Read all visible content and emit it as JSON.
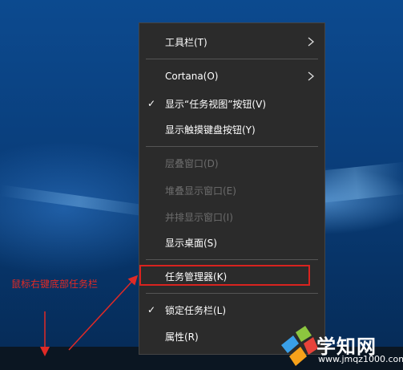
{
  "menu": {
    "items": [
      {
        "label": "工具栏(T)",
        "submenu": true,
        "checked": false,
        "disabled": false
      },
      {
        "label": "Cortana(O)",
        "submenu": true,
        "checked": false,
        "disabled": false
      },
      {
        "label": "显示“任务视图”按钮(V)",
        "submenu": false,
        "checked": true,
        "disabled": false
      },
      {
        "label": "显示触摸键盘按钮(Y)",
        "submenu": false,
        "checked": false,
        "disabled": false
      },
      {
        "label": "层叠窗口(D)",
        "submenu": false,
        "checked": false,
        "disabled": true
      },
      {
        "label": "堆叠显示窗口(E)",
        "submenu": false,
        "checked": false,
        "disabled": true
      },
      {
        "label": "并排显示窗口(I)",
        "submenu": false,
        "checked": false,
        "disabled": true
      },
      {
        "label": "显示桌面(S)",
        "submenu": false,
        "checked": false,
        "disabled": false
      },
      {
        "label": "任务管理器(K)",
        "submenu": false,
        "checked": false,
        "disabled": false
      },
      {
        "label": "锁定任务栏(L)",
        "submenu": false,
        "checked": true,
        "disabled": false
      },
      {
        "label": "属性(R)",
        "submenu": false,
        "checked": false,
        "disabled": false
      }
    ],
    "check_glyph": "✓"
  },
  "annotation": {
    "text": "鼠标右键底部任务栏",
    "color": "#e02a26"
  },
  "watermark": {
    "name": "学知网",
    "url": "www.jmqz1000.com"
  }
}
